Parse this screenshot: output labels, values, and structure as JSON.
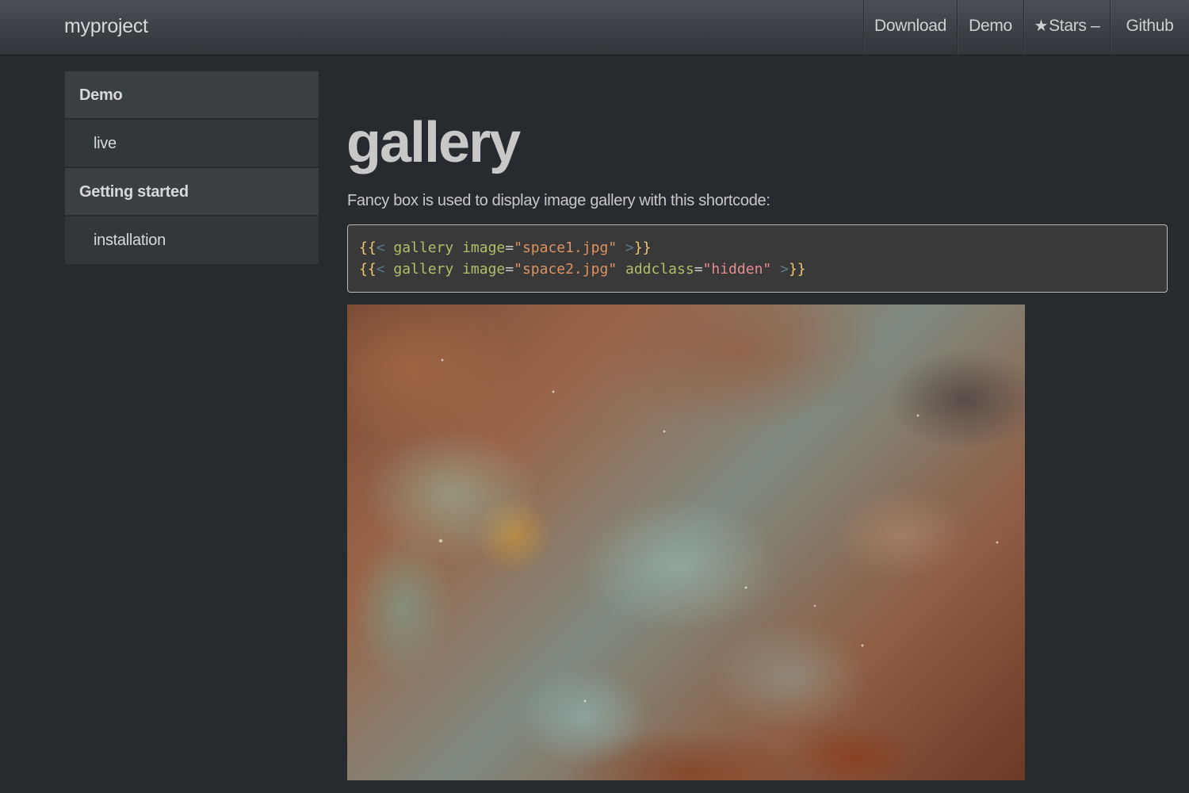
{
  "navbar": {
    "brand": "myproject",
    "items": [
      {
        "label": "Download"
      },
      {
        "label": "Demo"
      },
      {
        "label": "Stars –"
      },
      {
        "label": "Github"
      }
    ]
  },
  "sidebar": {
    "items": [
      {
        "label": "Demo",
        "type": "section"
      },
      {
        "label": "live",
        "type": "sub"
      },
      {
        "label": "Getting started",
        "type": "section"
      },
      {
        "label": "installation",
        "type": "sub"
      }
    ]
  },
  "main": {
    "title": "gallery",
    "intro": "Fancy box is used to display image gallery with this shortcode:",
    "code": {
      "line1": {
        "open": "{{",
        "lt": "<",
        "name": "gallery",
        "attr1": "image",
        "eq": "=",
        "val1": "\"space1.jpg\"",
        "gt": ">",
        "close": "}}"
      },
      "line2": {
        "open": "{{",
        "lt": "<",
        "name": "gallery",
        "attr1": "image",
        "eq": "=",
        "val1": "\"space2.jpg\"",
        "attr2": "addclass",
        "val2": "\"hidden\"",
        "gt": ">",
        "close": "}}"
      }
    },
    "image": {
      "icon": "nebula-image"
    }
  },
  "colors": {
    "background": "#272b30",
    "navbar": "#3a3f44",
    "sidebar_item": "#3a3f44",
    "code_bg": "#393939"
  }
}
